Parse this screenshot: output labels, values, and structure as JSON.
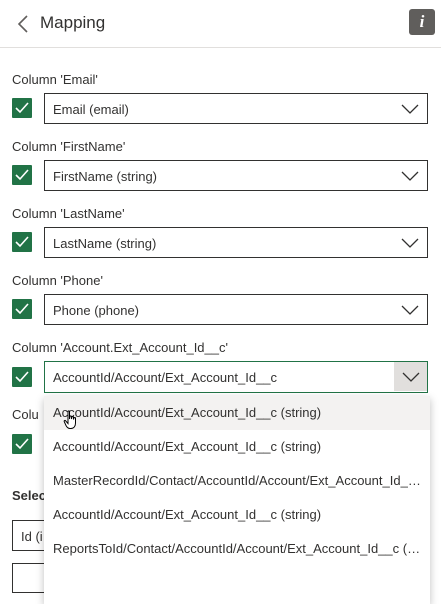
{
  "header": {
    "title": "Mapping",
    "info_icon_text": "i"
  },
  "mappings": [
    {
      "label": "Column 'Email'",
      "value": "Email (email)",
      "checked": true
    },
    {
      "label": "Column 'FirstName'",
      "value": "FirstName (string)",
      "checked": true
    },
    {
      "label": "Column 'LastName'",
      "value": "LastName (string)",
      "checked": true
    },
    {
      "label": "Column 'Phone'",
      "value": "Phone (phone)",
      "checked": true
    },
    {
      "label": "Column 'Account.Ext_Account_Id__c'",
      "value": "AccountId/Account/Ext_Account_Id__c",
      "checked": true,
      "open": true
    }
  ],
  "obscured": {
    "next_label_partial": "Colu",
    "select_label_partial": "Selec",
    "id_input_partial": "Id (i"
  },
  "dropdown_options": [
    "AccountId/Account/Ext_Account_Id__c (string)",
    "AccountId/Account/Ext_Account_Id__c (string)",
    "MasterRecordId/Contact/AccountId/Account/Ext_Account_Id__c (string)",
    "AccountId/Account/Ext_Account_Id__c (string)",
    "ReportsToId/Contact/AccountId/Account/Ext_Account_Id__c (string)"
  ],
  "colors": {
    "accent": "#217346",
    "text": "#323130",
    "border": "#323130",
    "hover": "#f3f2f1"
  }
}
